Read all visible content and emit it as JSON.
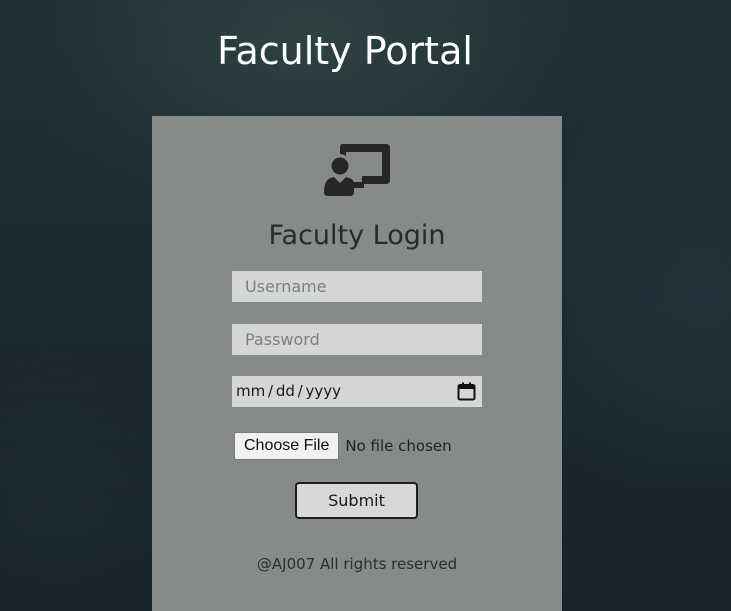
{
  "header": {
    "title": "Faculty Portal"
  },
  "login_card": {
    "icon": "chalkboard-teacher-icon",
    "title": "Faculty Login",
    "username": {
      "placeholder": "Username",
      "value": ""
    },
    "password": {
      "placeholder": "Password",
      "value": ""
    },
    "date": {
      "display": "mm / dd / yyyy",
      "icon": "calendar-icon"
    },
    "file": {
      "button_label": "Choose File",
      "status": "No file chosen"
    },
    "submit_label": "Submit",
    "footer": "@AJ007 All rights reserved"
  },
  "colors": {
    "card_background": "#878a8a",
    "input_background": "#d4d7d6",
    "page_background": "#1c2a32",
    "title_text": "#ffffff"
  }
}
